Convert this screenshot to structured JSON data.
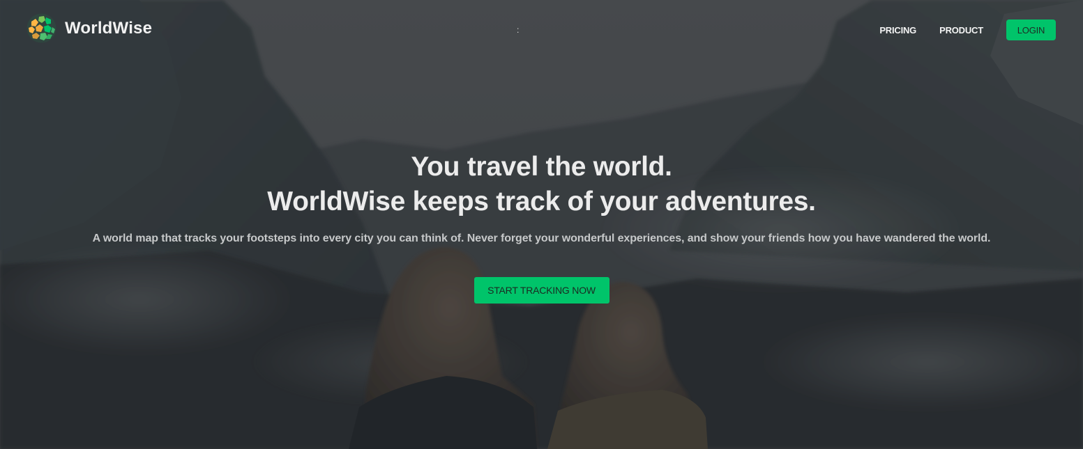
{
  "brand": {
    "name": "WorldWise",
    "logo_icon": "globe-hexagon-icon",
    "colors": {
      "green": "#00c46a",
      "yellow": "#ffb545",
      "teal": "#42b06e"
    }
  },
  "nav": {
    "center_text": ":",
    "pricing": "PRICING",
    "product": "PRODUCT",
    "login": "LOGIN"
  },
  "hero": {
    "headline_line1": "You travel the world.",
    "headline_line2": "WorldWise keeps track of your adventures.",
    "subline": "A world map that tracks your footsteps into every city you can think of. Never forget your wonderful experiences, and show your friends how you have wandered the world.",
    "cta": "START TRACKING NOW",
    "background_image": "mountain-valley-two-travelers-photo"
  }
}
